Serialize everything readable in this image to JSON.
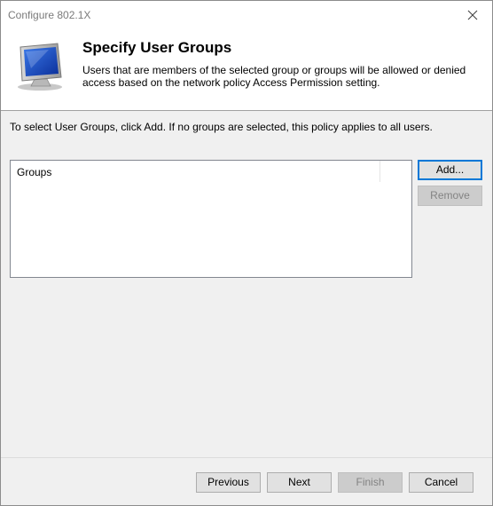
{
  "window": {
    "title": "Configure 802.1X"
  },
  "header": {
    "title": "Specify User Groups",
    "description": "Users that are members of the selected group or groups will be allowed or denied access based on the network policy Access Permission setting."
  },
  "instruction": "To select User Groups, click Add. If no groups are selected, this policy applies to all users.",
  "groups_list": {
    "column_header": "Groups",
    "items": []
  },
  "side_buttons": {
    "add": "Add...",
    "remove": "Remove"
  },
  "footer_buttons": {
    "previous": "Previous",
    "next": "Next",
    "finish": "Finish",
    "cancel": "Cancel"
  },
  "icons": {
    "header": "computer-monitor-icon",
    "close": "close-icon"
  },
  "colors": {
    "focus_border": "#0078d7",
    "title_text": "#7a7a7a"
  }
}
